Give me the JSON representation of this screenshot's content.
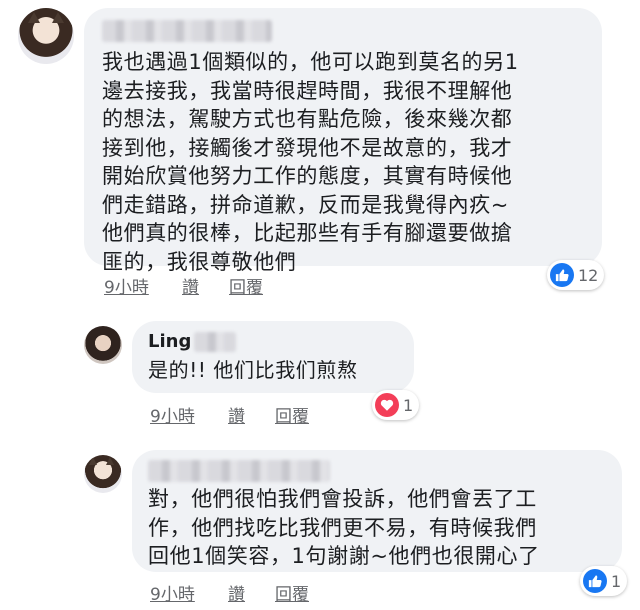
{
  "comments": [
    {
      "text": "我也遇過1個類似的，他可以跑到莫名的另1\n邊去接我，我當時很趕時間，我很不理解他\n的想法，駕駛方式也有點危險，後來幾次都\n接到他，接觸後才發現他不是故意的，我才\n開始欣賞他努力工作的態度，其實有時候他\n們走錯路，拼命道歉，反而是我覺得內疚~\n他們真的很棒，比起那些有手有腳還要做搶\n匪的，我很尊敬他們",
      "time": "9小時",
      "like_label": "讚",
      "reply_label": "回覆",
      "reaction_icon": "like-icon",
      "reaction_color": "#1877f2",
      "reaction_count": "12"
    },
    {
      "name": "Ling",
      "text": "是的!! 他们比我们煎熬",
      "time": "9小時",
      "like_label": "讚",
      "reply_label": "回覆",
      "reaction_icon": "heart-icon",
      "reaction_color": "#f33e58",
      "reaction_count": "1"
    },
    {
      "text": "對，他們很怕我們會投訴，他們會丟了工\n作，他們找吃比我們更不易，有時候我們\n回他1個笑容，1句謝謝~他們也很開心了",
      "time": "9小時",
      "like_label": "讚",
      "reply_label": "回覆",
      "reaction_icon": "like-icon",
      "reaction_color": "#1877f2",
      "reaction_count": "1"
    }
  ]
}
